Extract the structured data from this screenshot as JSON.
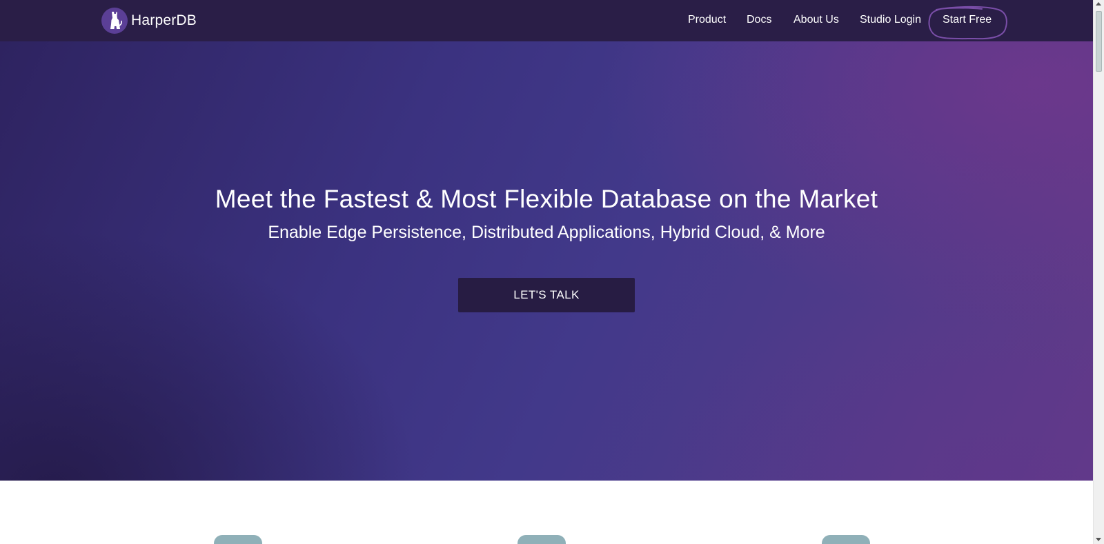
{
  "brand": {
    "name": "HarperDB"
  },
  "nav": {
    "items": [
      {
        "label": "Product"
      },
      {
        "label": "Docs"
      },
      {
        "label": "About Us"
      },
      {
        "label": "Studio Login"
      },
      {
        "label": "Start Free"
      }
    ]
  },
  "hero": {
    "title": "Meet the Fastest & Most Flexible Database on the Market",
    "subtitle": "Enable Edge Persistence, Distributed Applications, Hybrid Cloud, & More",
    "cta_label": "LET'S TALK"
  },
  "colors": {
    "nav_background": "#2a1e47",
    "cta_background": "#271c43",
    "annotation_circle": "#7a4ea8",
    "tab_color": "#8fb0b8"
  },
  "icons": {
    "logo": "harperdb-dog-logo-icon",
    "annotation": "hand-drawn-circle-annotation"
  }
}
